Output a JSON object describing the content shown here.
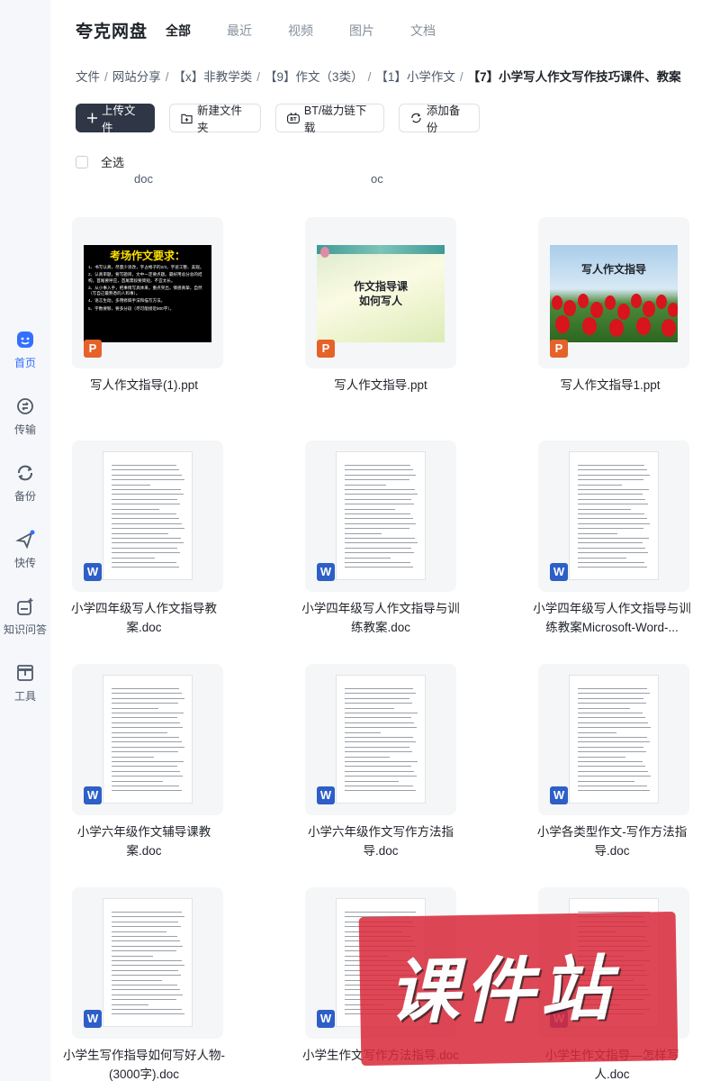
{
  "sidebar": {
    "items": [
      {
        "label": "首页",
        "icon": "home-icon",
        "active": true
      },
      {
        "label": "传输",
        "icon": "transfer-icon"
      },
      {
        "label": "备份",
        "icon": "backup-icon"
      },
      {
        "label": "快传",
        "icon": "quick-send-icon"
      },
      {
        "label": "知识问答",
        "icon": "knowledge-qa-icon"
      },
      {
        "label": "工具",
        "icon": "toolbox-icon"
      }
    ]
  },
  "header": {
    "logo": "夸克网盘",
    "tabs": [
      "全部",
      "最近",
      "视频",
      "图片",
      "文档"
    ],
    "active_tab": "全部"
  },
  "breadcrumb": [
    "文件",
    "网站分享",
    "【x】非教学类",
    "【9】作文（3类）",
    "【1】小学作文",
    "【7】小学写人作文写作技巧课件、教案"
  ],
  "toolbar": {
    "upload": "上传文件",
    "new_folder": "新建文件夹",
    "bt": "BT/磁力链下载",
    "backup": "添加备份"
  },
  "select_all": "全选",
  "cut_names": [
    "doc",
    "oc"
  ],
  "files": [
    {
      "name": "写人作文指导(1).ppt",
      "type": "ppt"
    },
    {
      "name": "写人作文指导.ppt",
      "type": "ppt"
    },
    {
      "name": "写人作文指导1.ppt",
      "type": "ppt"
    },
    {
      "name": "小学四年级写人作文指导教案.doc",
      "type": "doc"
    },
    {
      "name": "小学四年级写人作文指导与训练教案.doc",
      "type": "doc"
    },
    {
      "name": "小学四年级写人作文指导与训练教案Microsoft-Word-...",
      "type": "doc"
    },
    {
      "name": "小学六年级作文辅导课教案.doc",
      "type": "doc"
    },
    {
      "name": "小学六年级作文写作方法指导.doc",
      "type": "doc"
    },
    {
      "name": "小学各类型作文-写作方法指导.doc",
      "type": "doc"
    },
    {
      "name": "小学生写作指导如何写好人物-(3000字).doc",
      "type": "doc"
    },
    {
      "name": "小学生作文写作方法指导.doc",
      "type": "doc"
    },
    {
      "name": "小学生作文指导—怎样写人.doc",
      "type": "doc"
    }
  ],
  "slides": {
    "s1_title": "考场作文要求：",
    "s1_lines": [
      "1、书写认真，尽量少涂改，字占格子的2/3，字迹工整、美观。",
      "2、认真审题，要写题目，文中一定要点题。最好用总分总的结构，首尾要呼应，首尾需段要简短，不宜太长。",
      "3、从小事入手，把事情写具体来，重点突出，情感真挚，自然（写自己最熟悉的人和事）。",
      "4、语言生动，多用修辞手法和描写方法。",
      "5、字数要够，要多分段（尽可能接近800字）。"
    ],
    "s2_line1": "作文指导课",
    "s2_line2": "如何写人",
    "s3_title": "写人作文指导"
  },
  "badges": {
    "ppt": "P",
    "doc": "W"
  },
  "watermark": "课件站",
  "colors": {
    "accent": "#3370ff",
    "primary_button": "#2f3645",
    "ppt_badge": "#e5622b",
    "doc_badge": "#2d5fc7",
    "watermark": "#d9293a"
  }
}
